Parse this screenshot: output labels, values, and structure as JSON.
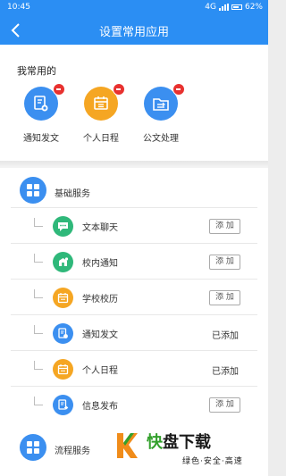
{
  "status_bar": {
    "time": "10:45",
    "network": "4G",
    "battery": "62%"
  },
  "header": {
    "title": "设置常用应用",
    "back_icon": "back-arrow-icon"
  },
  "favorites": {
    "heading": "我常用的",
    "items": [
      {
        "label": "通知发文",
        "icon": "notice-doc-icon",
        "color": "#3b8ff0"
      },
      {
        "label": "个人日程",
        "icon": "calendar-icon",
        "color": "#f5a623"
      },
      {
        "label": "公文处理",
        "icon": "folder-transfer-icon",
        "color": "#3b8ff0"
      }
    ]
  },
  "groups": [
    {
      "title": "基础服务",
      "icon": "grid-icon",
      "items": [
        {
          "name": "文本聊天",
          "icon": "chat-icon",
          "color": "#2fb87a",
          "action": "添 加"
        },
        {
          "name": "校内通知",
          "icon": "school-notice-icon",
          "color": "#2fb87a",
          "action": "添 加"
        },
        {
          "name": "学校校历",
          "icon": "calendar-icon",
          "color": "#f5a623",
          "action": "添 加"
        },
        {
          "name": "通知发文",
          "icon": "notice-doc-icon",
          "color": "#3b8ff0",
          "status": "已添加"
        },
        {
          "name": "个人日程",
          "icon": "calendar-icon",
          "color": "#f5a623",
          "status": "已添加"
        },
        {
          "name": "信息发布",
          "icon": "publish-icon",
          "color": "#3b8ff0",
          "action": "添 加"
        }
      ]
    },
    {
      "title": "流程服务",
      "icon": "grid-icon"
    }
  ],
  "watermark": {
    "main_part1": "快",
    "main_part2": "盘下载",
    "sub": "绿色·安全·高速"
  },
  "colors": {
    "primary": "#2b8ef3",
    "remove_badge": "#e8312f"
  }
}
